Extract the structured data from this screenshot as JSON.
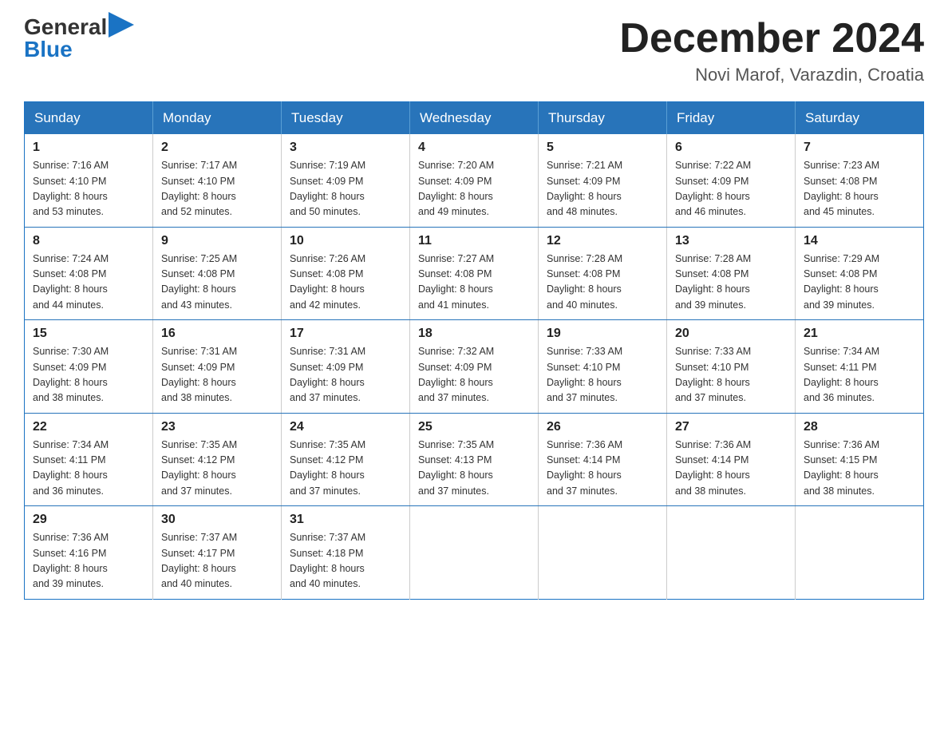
{
  "header": {
    "logo_general": "General",
    "logo_blue": "Blue",
    "month_title": "December 2024",
    "location": "Novi Marof, Varazdin, Croatia"
  },
  "columns": [
    "Sunday",
    "Monday",
    "Tuesday",
    "Wednesday",
    "Thursday",
    "Friday",
    "Saturday"
  ],
  "weeks": [
    [
      {
        "day": "1",
        "sunrise": "Sunrise: 7:16 AM",
        "sunset": "Sunset: 4:10 PM",
        "daylight": "Daylight: 8 hours",
        "minutes": "and 53 minutes."
      },
      {
        "day": "2",
        "sunrise": "Sunrise: 7:17 AM",
        "sunset": "Sunset: 4:10 PM",
        "daylight": "Daylight: 8 hours",
        "minutes": "and 52 minutes."
      },
      {
        "day": "3",
        "sunrise": "Sunrise: 7:19 AM",
        "sunset": "Sunset: 4:09 PM",
        "daylight": "Daylight: 8 hours",
        "minutes": "and 50 minutes."
      },
      {
        "day": "4",
        "sunrise": "Sunrise: 7:20 AM",
        "sunset": "Sunset: 4:09 PM",
        "daylight": "Daylight: 8 hours",
        "minutes": "and 49 minutes."
      },
      {
        "day": "5",
        "sunrise": "Sunrise: 7:21 AM",
        "sunset": "Sunset: 4:09 PM",
        "daylight": "Daylight: 8 hours",
        "minutes": "and 48 minutes."
      },
      {
        "day": "6",
        "sunrise": "Sunrise: 7:22 AM",
        "sunset": "Sunset: 4:09 PM",
        "daylight": "Daylight: 8 hours",
        "minutes": "and 46 minutes."
      },
      {
        "day": "7",
        "sunrise": "Sunrise: 7:23 AM",
        "sunset": "Sunset: 4:08 PM",
        "daylight": "Daylight: 8 hours",
        "minutes": "and 45 minutes."
      }
    ],
    [
      {
        "day": "8",
        "sunrise": "Sunrise: 7:24 AM",
        "sunset": "Sunset: 4:08 PM",
        "daylight": "Daylight: 8 hours",
        "minutes": "and 44 minutes."
      },
      {
        "day": "9",
        "sunrise": "Sunrise: 7:25 AM",
        "sunset": "Sunset: 4:08 PM",
        "daylight": "Daylight: 8 hours",
        "minutes": "and 43 minutes."
      },
      {
        "day": "10",
        "sunrise": "Sunrise: 7:26 AM",
        "sunset": "Sunset: 4:08 PM",
        "daylight": "Daylight: 8 hours",
        "minutes": "and 42 minutes."
      },
      {
        "day": "11",
        "sunrise": "Sunrise: 7:27 AM",
        "sunset": "Sunset: 4:08 PM",
        "daylight": "Daylight: 8 hours",
        "minutes": "and 41 minutes."
      },
      {
        "day": "12",
        "sunrise": "Sunrise: 7:28 AM",
        "sunset": "Sunset: 4:08 PM",
        "daylight": "Daylight: 8 hours",
        "minutes": "and 40 minutes."
      },
      {
        "day": "13",
        "sunrise": "Sunrise: 7:28 AM",
        "sunset": "Sunset: 4:08 PM",
        "daylight": "Daylight: 8 hours",
        "minutes": "and 39 minutes."
      },
      {
        "day": "14",
        "sunrise": "Sunrise: 7:29 AM",
        "sunset": "Sunset: 4:08 PM",
        "daylight": "Daylight: 8 hours",
        "minutes": "and 39 minutes."
      }
    ],
    [
      {
        "day": "15",
        "sunrise": "Sunrise: 7:30 AM",
        "sunset": "Sunset: 4:09 PM",
        "daylight": "Daylight: 8 hours",
        "minutes": "and 38 minutes."
      },
      {
        "day": "16",
        "sunrise": "Sunrise: 7:31 AM",
        "sunset": "Sunset: 4:09 PM",
        "daylight": "Daylight: 8 hours",
        "minutes": "and 38 minutes."
      },
      {
        "day": "17",
        "sunrise": "Sunrise: 7:31 AM",
        "sunset": "Sunset: 4:09 PM",
        "daylight": "Daylight: 8 hours",
        "minutes": "and 37 minutes."
      },
      {
        "day": "18",
        "sunrise": "Sunrise: 7:32 AM",
        "sunset": "Sunset: 4:09 PM",
        "daylight": "Daylight: 8 hours",
        "minutes": "and 37 minutes."
      },
      {
        "day": "19",
        "sunrise": "Sunrise: 7:33 AM",
        "sunset": "Sunset: 4:10 PM",
        "daylight": "Daylight: 8 hours",
        "minutes": "and 37 minutes."
      },
      {
        "day": "20",
        "sunrise": "Sunrise: 7:33 AM",
        "sunset": "Sunset: 4:10 PM",
        "daylight": "Daylight: 8 hours",
        "minutes": "and 37 minutes."
      },
      {
        "day": "21",
        "sunrise": "Sunrise: 7:34 AM",
        "sunset": "Sunset: 4:11 PM",
        "daylight": "Daylight: 8 hours",
        "minutes": "and 36 minutes."
      }
    ],
    [
      {
        "day": "22",
        "sunrise": "Sunrise: 7:34 AM",
        "sunset": "Sunset: 4:11 PM",
        "daylight": "Daylight: 8 hours",
        "minutes": "and 36 minutes."
      },
      {
        "day": "23",
        "sunrise": "Sunrise: 7:35 AM",
        "sunset": "Sunset: 4:12 PM",
        "daylight": "Daylight: 8 hours",
        "minutes": "and 37 minutes."
      },
      {
        "day": "24",
        "sunrise": "Sunrise: 7:35 AM",
        "sunset": "Sunset: 4:12 PM",
        "daylight": "Daylight: 8 hours",
        "minutes": "and 37 minutes."
      },
      {
        "day": "25",
        "sunrise": "Sunrise: 7:35 AM",
        "sunset": "Sunset: 4:13 PM",
        "daylight": "Daylight: 8 hours",
        "minutes": "and 37 minutes."
      },
      {
        "day": "26",
        "sunrise": "Sunrise: 7:36 AM",
        "sunset": "Sunset: 4:14 PM",
        "daylight": "Daylight: 8 hours",
        "minutes": "and 37 minutes."
      },
      {
        "day": "27",
        "sunrise": "Sunrise: 7:36 AM",
        "sunset": "Sunset: 4:14 PM",
        "daylight": "Daylight: 8 hours",
        "minutes": "and 38 minutes."
      },
      {
        "day": "28",
        "sunrise": "Sunrise: 7:36 AM",
        "sunset": "Sunset: 4:15 PM",
        "daylight": "Daylight: 8 hours",
        "minutes": "and 38 minutes."
      }
    ],
    [
      {
        "day": "29",
        "sunrise": "Sunrise: 7:36 AM",
        "sunset": "Sunset: 4:16 PM",
        "daylight": "Daylight: 8 hours",
        "minutes": "and 39 minutes."
      },
      {
        "day": "30",
        "sunrise": "Sunrise: 7:37 AM",
        "sunset": "Sunset: 4:17 PM",
        "daylight": "Daylight: 8 hours",
        "minutes": "and 40 minutes."
      },
      {
        "day": "31",
        "sunrise": "Sunrise: 7:37 AM",
        "sunset": "Sunset: 4:18 PM",
        "daylight": "Daylight: 8 hours",
        "minutes": "and 40 minutes."
      },
      null,
      null,
      null,
      null
    ]
  ]
}
